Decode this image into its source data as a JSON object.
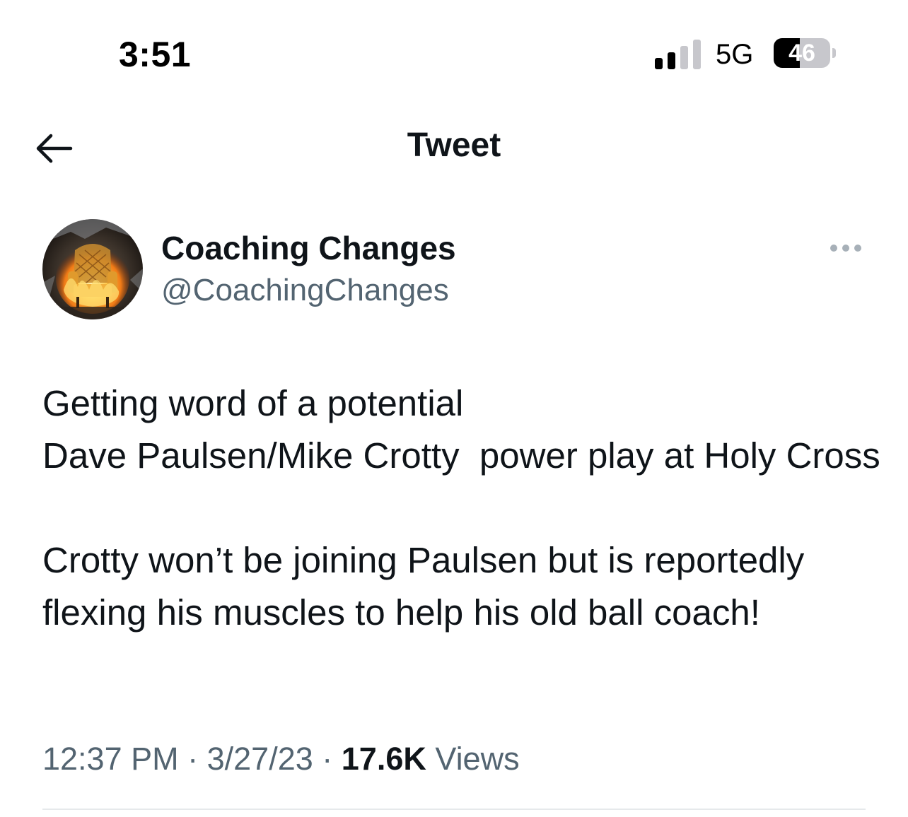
{
  "status_bar": {
    "time": "3:51",
    "network": "5G",
    "battery_level": "46",
    "battery_fraction": 0.46,
    "signal_bars": 2,
    "signal_bars_total": 4
  },
  "header": {
    "title": "Tweet",
    "back_icon": "back-arrow-icon"
  },
  "author": {
    "name": "Coaching Changes",
    "handle": "@CoachingChanges",
    "more_icon": "more-options-icon"
  },
  "tweet": {
    "text": "Getting word of a potential\nDave Paulsen/Mike Crotty  power play at Holy Cross\n\nCrotty won’t be joining Paulsen but is reportedly flexing his muscles to help his old ball coach!",
    "time": "12:37 PM",
    "separator": " · ",
    "date": "3/27/23",
    "views_count": "17.6K",
    "views_label": " Views"
  },
  "colors": {
    "text_primary": "#0f1419",
    "text_secondary": "#536471",
    "divider": "#e6e9eb"
  }
}
